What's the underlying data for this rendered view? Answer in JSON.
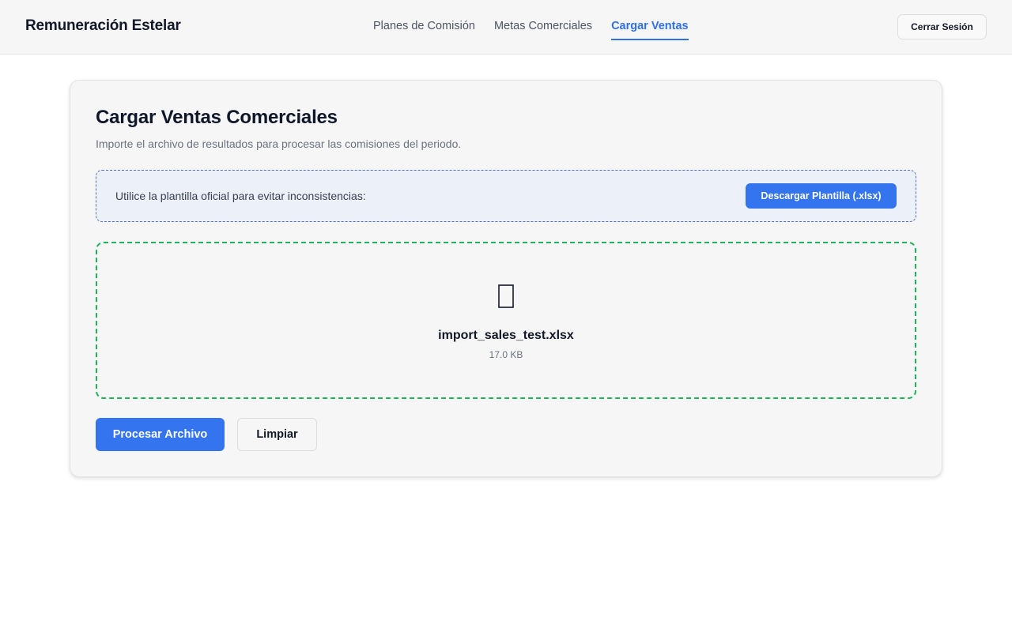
{
  "header": {
    "brand": "Remuneración Estelar",
    "nav": [
      {
        "label": "Planes de Comisión",
        "active": false
      },
      {
        "label": "Metas Comerciales",
        "active": false
      },
      {
        "label": "Cargar Ventas",
        "active": true
      }
    ],
    "logout_label": "Cerrar Sesión"
  },
  "upload": {
    "title": "Cargar Ventas Comerciales",
    "subtitle": "Importe el archivo de resultados para procesar las comisiones del periodo.",
    "template_notice": "Utilice la plantilla oficial para evitar inconsistencias:",
    "download_label": "Descargar Plantilla (.xlsx)",
    "file": {
      "icon": "file-icon",
      "name": "import_sales_test.xlsx",
      "size": "17.0 KB"
    },
    "process_label": "Procesar Archivo",
    "clear_label": "Limpiar"
  },
  "colors": {
    "accent": "#3474ee",
    "active_nav": "#2f6fec",
    "dropzone_border": "#22b35a",
    "notice_border": "#4d72d2",
    "notice_bg": "#ecf0f8"
  }
}
